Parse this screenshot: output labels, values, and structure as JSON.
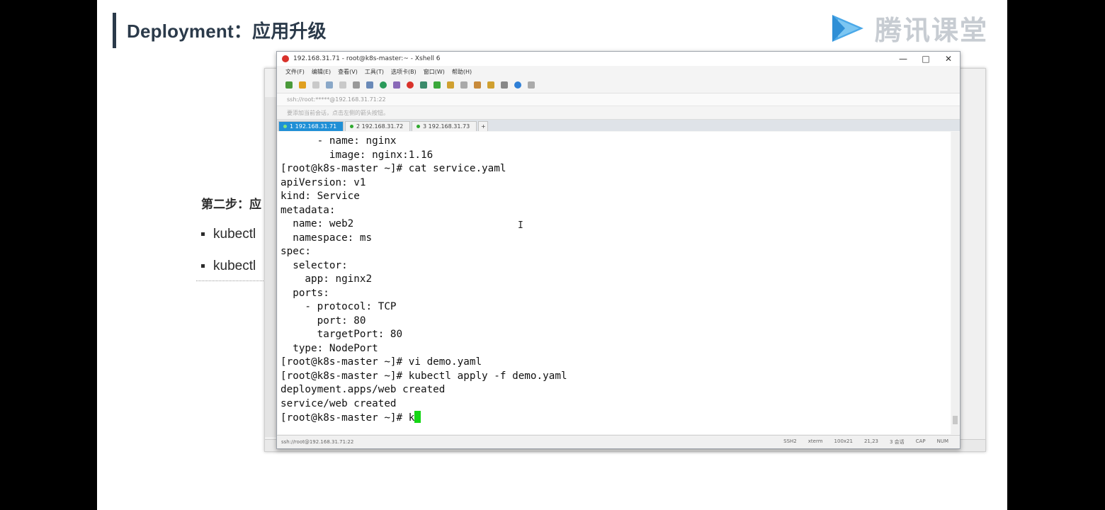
{
  "slide": {
    "title": "Deployment：应用升级",
    "logo_text": "腾讯课堂",
    "step_title": "第二步：应",
    "bullets": [
      "kubectl",
      "kubectl"
    ]
  },
  "xshell": {
    "window_title": "192.168.31.71 - root@k8s-master:~ - Xshell 6",
    "controls": {
      "minimize": "—",
      "maximize": "□",
      "close": "✕"
    },
    "menu": [
      "文件(F)",
      "编辑(E)",
      "查看(V)",
      "工具(T)",
      "选项卡(B)",
      "窗口(W)",
      "帮助(H)"
    ],
    "address": "ssh://root:*****@192.168.31.71:22",
    "hint": "要添加当前会话，点击左侧的箭头按钮。",
    "tabs": [
      {
        "label": "1 192.168.31.71",
        "active": true
      },
      {
        "label": "2 192.168.31.72",
        "active": false
      },
      {
        "label": "3 192.168.31.73",
        "active": false
      }
    ],
    "add_tab": "+",
    "terminal_lines": [
      "      - name: nginx",
      "        image: nginx:1.16",
      "[root@k8s-master ~]# cat service.yaml",
      "apiVersion: v1",
      "kind: Service",
      "metadata:",
      "  name: web2",
      "  namespace: ms",
      "spec:",
      "  selector:",
      "    app: nginx2",
      "  ports:",
      "    - protocol: TCP",
      "      port: 80",
      "      targetPort: 80",
      "  type: NodePort",
      "[root@k8s-master ~]# vi demo.yaml",
      "[root@k8s-master ~]# kubectl apply -f demo.yaml",
      "deployment.apps/web created",
      "service/web created",
      "[root@k8s-master ~]# k"
    ],
    "status": {
      "connection": "ssh://root@192.168.31.71:22",
      "protocol": "SSH2",
      "terminal": "xterm",
      "size": "100x21",
      "position": "21,23",
      "sessions": "3 会话",
      "caps": "CAP",
      "num": "NUM"
    }
  },
  "colors": {
    "accent": "#1f8fd6",
    "cursor": "#15d615",
    "title": "#2b3a4a"
  }
}
